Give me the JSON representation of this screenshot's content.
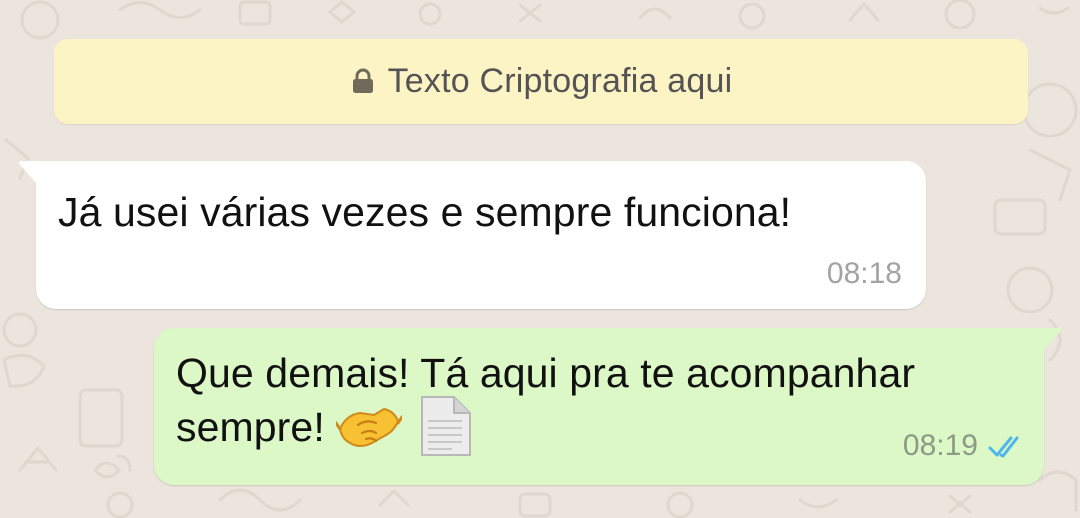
{
  "encryption_banner": {
    "text": "Texto Criptografia aqui",
    "icon": "lock-icon",
    "background": "#fdf4c5"
  },
  "messages": [
    {
      "direction": "incoming",
      "text": "Já usei várias vezes e sempre funciona!",
      "time": "08:18",
      "background": "#ffffff"
    },
    {
      "direction": "outgoing",
      "text_line1": "Que demais! Tá aqui pra te acompanhar",
      "text_line2": "sempre!",
      "emojis": [
        "handshake-emoji",
        "document-emoji"
      ],
      "time": "08:19",
      "status": "read",
      "status_icon": "double-check-icon",
      "status_color": "#4fb6ec",
      "background": "#dcf8c6"
    }
  ],
  "colors": {
    "wallpaper": "#ece5dd"
  }
}
